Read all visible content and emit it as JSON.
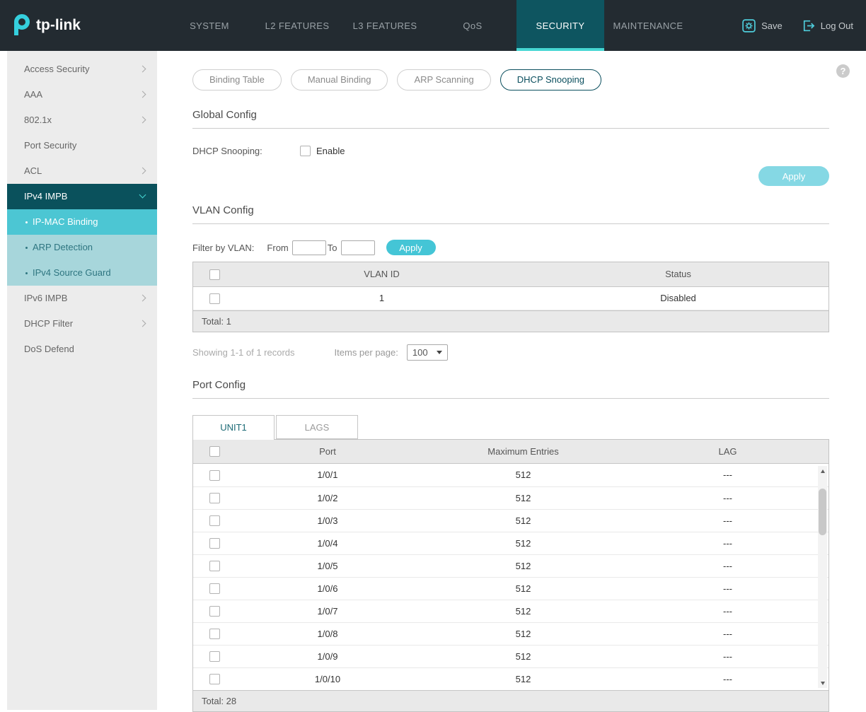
{
  "colors": {
    "accent_cyan": "#46d7d3",
    "active_nav_bg": "#0e5560",
    "sidebar_expanded": "#0a515c",
    "sidebar_active": "#4cc6d3",
    "apply_light": "#85d8e4",
    "apply_solid": "#44c5d6",
    "brand_teal": "#35cfdd"
  },
  "topnav": {
    "brand": "tp-link",
    "items": [
      {
        "label": "SYSTEM",
        "state": ""
      },
      {
        "label": "L2 FEATURES",
        "state": ""
      },
      {
        "label": "L3 FEATURES",
        "state": ""
      },
      {
        "label": "QoS",
        "state": ""
      },
      {
        "label": "SECURITY",
        "state": "active"
      },
      {
        "label": "MAINTENANCE",
        "state": ""
      }
    ],
    "save_label": "Save",
    "logout_label": "Log Out"
  },
  "sidebar": {
    "items": [
      {
        "label": "Access Security",
        "state": "has-chevron"
      },
      {
        "label": "AAA",
        "state": "has-chevron"
      },
      {
        "label": "802.1x",
        "state": "has-chevron"
      },
      {
        "label": "Port Security",
        "state": ""
      },
      {
        "label": "ACL",
        "state": "has-chevron"
      },
      {
        "label": "IPv4 IMPB",
        "state": "expanded"
      },
      {
        "label": "IP-MAC Binding",
        "state": "sub active"
      },
      {
        "label": "ARP Detection",
        "state": "sub"
      },
      {
        "label": "IPv4 Source Guard",
        "state": "sub"
      },
      {
        "label": "IPv6 IMPB",
        "state": "has-chevron"
      },
      {
        "label": "DHCP Filter",
        "state": "has-chevron"
      },
      {
        "label": "DoS Defend",
        "state": ""
      }
    ]
  },
  "content": {
    "help_icon": "?",
    "tabs": [
      {
        "label": "Binding Table",
        "state": ""
      },
      {
        "label": "Manual Binding",
        "state": ""
      },
      {
        "label": "ARP Scanning",
        "state": ""
      },
      {
        "label": "DHCP Snooping",
        "state": "active"
      }
    ],
    "global_config": {
      "title": "Global Config",
      "field_label": "DHCP Snooping:",
      "checkbox_label": "Enable",
      "checkbox_checked": false,
      "apply_label": "Apply"
    },
    "vlan_config": {
      "title": "VLAN Config",
      "filter_label": "Filter by VLAN:",
      "from_label": "From",
      "from_value": "",
      "to_label": "To",
      "to_value": "",
      "apply_label": "Apply",
      "table": {
        "columns": [
          "VLAN ID",
          "Status"
        ],
        "rows": [
          {
            "vlan_id": "1",
            "status": "Disabled"
          }
        ],
        "total_label": "Total: 1"
      },
      "pagination": {
        "showing_label": "Showing 1-1 of 1 records",
        "items_per_page_label": "Items per page:",
        "items_per_page_value": "100"
      }
    },
    "port_config": {
      "title": "Port Config",
      "unit_tabs": [
        {
          "label": "UNIT1",
          "state": "active"
        },
        {
          "label": "LAGS",
          "state": ""
        }
      ],
      "table": {
        "columns": [
          "Port",
          "Maximum Entries",
          "LAG"
        ],
        "rows": [
          {
            "port": "1/0/1",
            "max_entries": "512",
            "lag": "---"
          },
          {
            "port": "1/0/2",
            "max_entries": "512",
            "lag": "---"
          },
          {
            "port": "1/0/3",
            "max_entries": "512",
            "lag": "---"
          },
          {
            "port": "1/0/4",
            "max_entries": "512",
            "lag": "---"
          },
          {
            "port": "1/0/5",
            "max_entries": "512",
            "lag": "---"
          },
          {
            "port": "1/0/6",
            "max_entries": "512",
            "lag": "---"
          },
          {
            "port": "1/0/7",
            "max_entries": "512",
            "lag": "---"
          },
          {
            "port": "1/0/8",
            "max_entries": "512",
            "lag": "---"
          },
          {
            "port": "1/0/9",
            "max_entries": "512",
            "lag": "---"
          },
          {
            "port": "1/0/10",
            "max_entries": "512",
            "lag": "---"
          }
        ],
        "total_label": "Total: 28"
      }
    }
  }
}
